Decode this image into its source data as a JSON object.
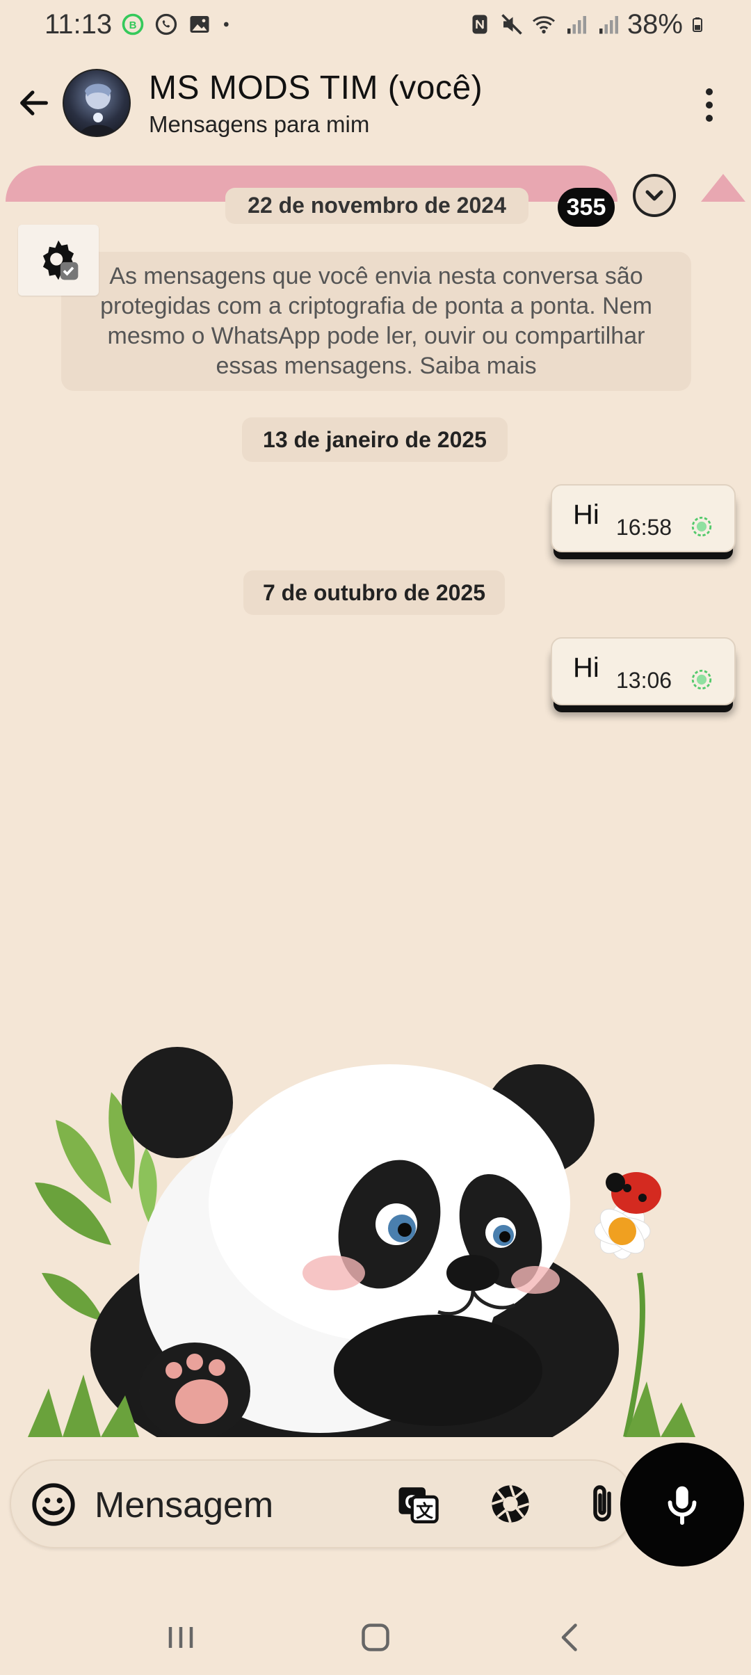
{
  "status_bar": {
    "time": "11:13",
    "battery": "38%",
    "left_icons": [
      "whatsapp-business-icon",
      "whatsapp-icon",
      "gallery-icon",
      "dot-icon"
    ],
    "right_icons": [
      "nfc-icon",
      "mute-icon",
      "wifi-icon",
      "signal-icon",
      "signal-icon",
      "battery-icon"
    ]
  },
  "header": {
    "title": "MS MODS TIM (você)",
    "subtitle": "Mensagens para mim"
  },
  "chat": {
    "unread_count": "355",
    "top_date": "22 de novembro de 2024",
    "encryption_notice": "As mensagens que você envia nesta conversa são protegidas com a criptografia de ponta a ponta. Nem mesmo o WhatsApp pode ler, ouvir ou compartilhar essas mensagens. Saiba mais",
    "date_separators": [
      "13 de janeiro de 2025",
      "7 de outubro de 2025"
    ],
    "messages": [
      {
        "text": "Hi",
        "time": "16:58",
        "status": "sent"
      },
      {
        "text": "Hi",
        "time": "13:06",
        "status": "sent"
      }
    ]
  },
  "compose": {
    "placeholder": "Mensagem"
  },
  "colors": {
    "wallpaper": "#f4e6d6",
    "bubble": "#f7efe3",
    "date_chip": "#ecdccb",
    "pink_accent": "#e8a7b1",
    "tick_green": "#53c96b",
    "mic_button": "#050505"
  }
}
